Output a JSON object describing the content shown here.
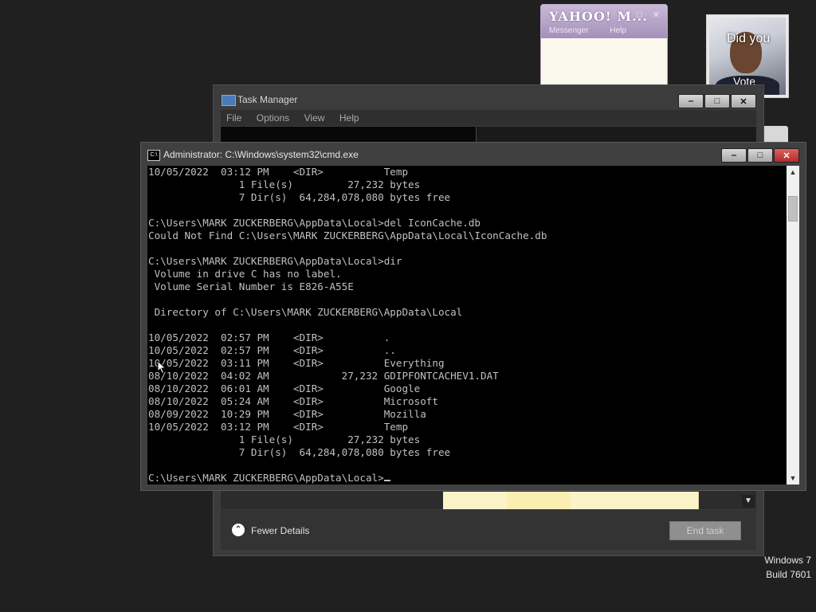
{
  "yahoo": {
    "logo": "YAHOO! M...",
    "menu": [
      "Messenger",
      "Help"
    ],
    "controls": "– □ ✕"
  },
  "photo_gadget": {
    "caption_top": "Did you",
    "caption_bottom": "Vote"
  },
  "task_manager": {
    "title": "Task Manager",
    "menu": [
      "File",
      "Options",
      "View",
      "Help"
    ],
    "fewer_details": "Fewer Details",
    "end_task": "End task",
    "controls": {
      "minimize": "‒",
      "maximize": "□",
      "close": "✕"
    }
  },
  "cmd": {
    "title": "Administrator: C:\\Windows\\system32\\cmd.exe",
    "icon": "C:\\",
    "controls": {
      "minimize": "‒",
      "maximize": "□",
      "close": "✕"
    },
    "lines": [
      "10/05/2022  03:12 PM    <DIR>          Temp",
      "               1 File(s)         27,232 bytes",
      "               7 Dir(s)  64,284,078,080 bytes free",
      "",
      "C:\\Users\\MARK ZUCKERBERG\\AppData\\Local>del IconCache.db",
      "Could Not Find C:\\Users\\MARK ZUCKERBERG\\AppData\\Local\\IconCache.db",
      "",
      "C:\\Users\\MARK ZUCKERBERG\\AppData\\Local>dir",
      " Volume in drive C has no label.",
      " Volume Serial Number is E826-A55E",
      "",
      " Directory of C:\\Users\\MARK ZUCKERBERG\\AppData\\Local",
      "",
      "10/05/2022  02:57 PM    <DIR>          .",
      "10/05/2022  02:57 PM    <DIR>          ..",
      "10/05/2022  03:11 PM    <DIR>          Everything",
      "08/10/2022  04:02 AM            27,232 GDIPFONTCACHEV1.DAT",
      "08/10/2022  06:01 AM    <DIR>          Google",
      "08/10/2022  05:24 AM    <DIR>          Microsoft",
      "08/09/2022  10:29 PM    <DIR>          Mozilla",
      "10/05/2022  03:12 PM    <DIR>          Temp",
      "               1 File(s)         27,232 bytes",
      "               7 Dir(s)  64,284,078,080 bytes free",
      ""
    ],
    "prompt": "C:\\Users\\MARK ZUCKERBERG\\AppData\\Local>"
  },
  "watermark": {
    "line1": "Windows 7",
    "line2": "Build 7601"
  }
}
